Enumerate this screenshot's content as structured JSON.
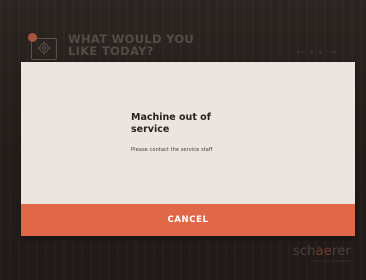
{
  "header": {
    "title": "What would you\nlike today?",
    "settings_icon": "gear-icon",
    "notification_color": "#a6553d",
    "pager_prev_icon": "arrow-left-icon",
    "pager_next_icon": "arrow-right-icon"
  },
  "dialog": {
    "title": "Machine out of\nservice",
    "message": "Please contact the service staff",
    "cancel_label": "CANCEL",
    "cancel_color": "#e06848"
  },
  "brand": {
    "name_start": "sch",
    "name_accent": "ae",
    "name_end": "rer",
    "tagline": "swiss coffee competence"
  }
}
